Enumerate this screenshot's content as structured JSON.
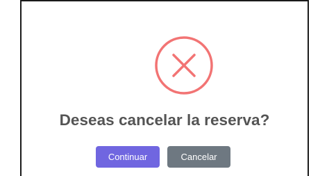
{
  "dialog": {
    "icon": "error-x-icon",
    "title": "Deseas cancelar la reserva?",
    "confirm_label": "Continuar",
    "cancel_label": "Cancelar"
  },
  "colors": {
    "icon": "#f27474",
    "title": "#545454",
    "confirm_button": "#7066e0",
    "cancel_button": "#6e7881",
    "border": "#1a1a1a"
  }
}
